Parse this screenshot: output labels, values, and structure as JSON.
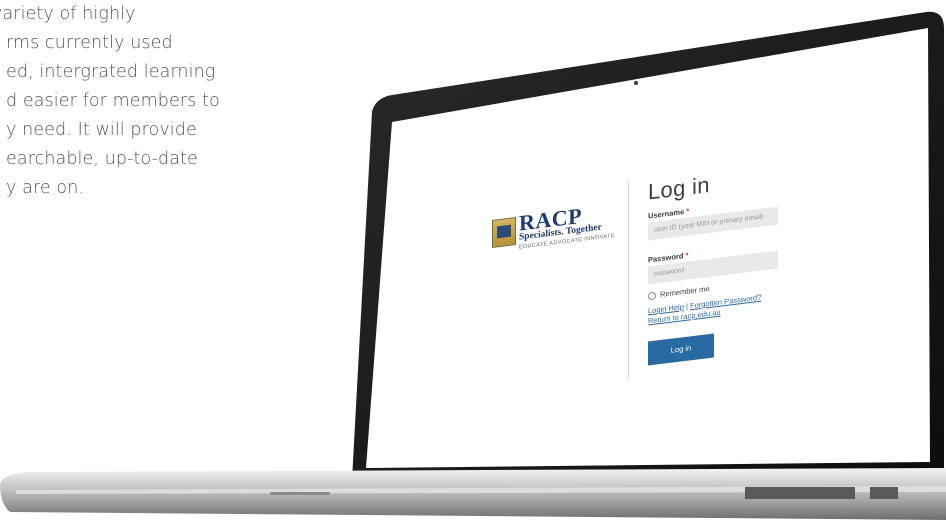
{
  "intro": {
    "lines": [
      "variety of highly",
      "rms currently used",
      "ed, intergrated learning",
      "d easier for members to",
      "y need. It will provide",
      "earchable, up-to-date",
      "y are on."
    ]
  },
  "logo": {
    "name": "RACP",
    "subtitle": "Specialists. Together",
    "tagline": "EDUCATE ADVOCATE INNOVATE"
  },
  "login": {
    "title": "Log in",
    "username_label": "Username",
    "username_placeholder": "user ID (your MIN or primary email)",
    "password_label": "Password",
    "password_placeholder": "password",
    "required_mark": "*",
    "remember_label": "Remember me",
    "login_help": "Login Help",
    "separator": " | ",
    "forgotten_password": "Forgotten Password?",
    "return_link": "Return to racp.edu.au",
    "submit": "Log in"
  },
  "colors": {
    "accent": "#2a6aa2",
    "link": "#2f67a8",
    "required": "#dd2233",
    "brand": "#1e3a6e"
  }
}
